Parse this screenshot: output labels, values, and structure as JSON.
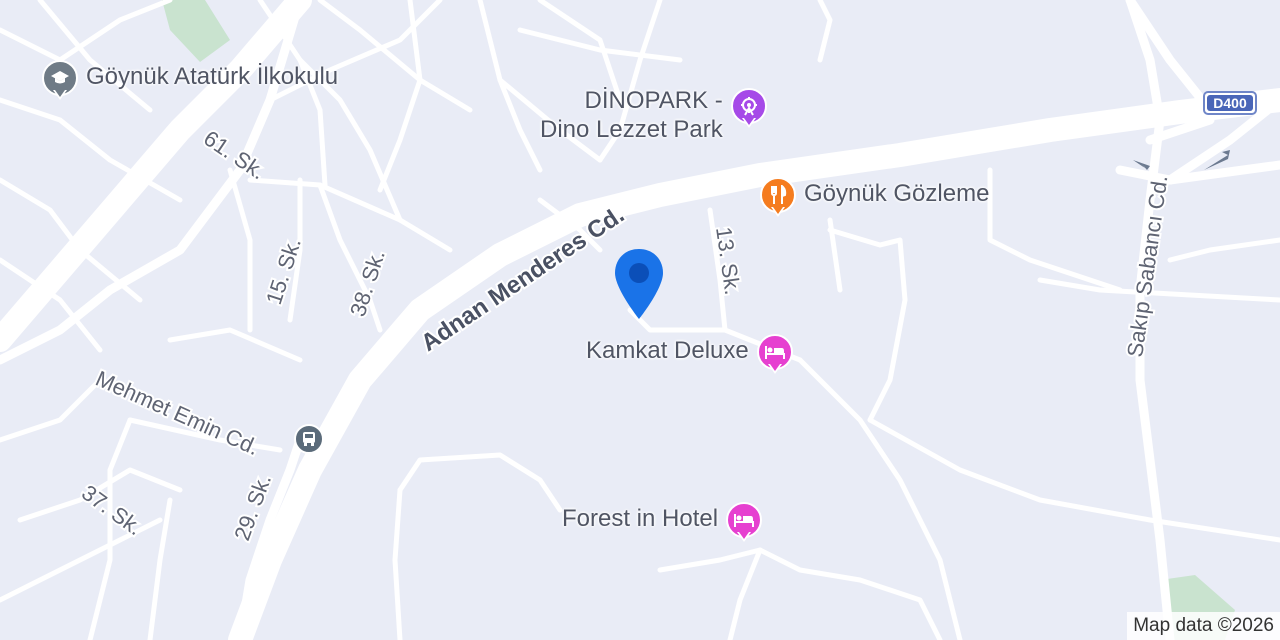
{
  "map": {
    "roads": [
      {
        "label": "Adnan Menderes Cd."
      },
      {
        "label": "61. Sk."
      },
      {
        "label": "15. Sk."
      },
      {
        "label": "38. Sk."
      },
      {
        "label": "13. Sk."
      },
      {
        "label": "Mehmet Emin Cd."
      },
      {
        "label": "37. Sk."
      },
      {
        "label": "29. Sk."
      },
      {
        "label": "Sakıp Sabancı Cd."
      }
    ],
    "highway_shield": "D400",
    "pois": {
      "school": {
        "line1": "Göynük Atatürk İlkokulu",
        "icon": "school-icon",
        "color": "#6f7b86"
      },
      "dinopark": {
        "line1": "DİNOPARK -",
        "line2": "Dino Lezzet Park",
        "icon": "amusement-park-icon",
        "color": "#a64ae8"
      },
      "gozleme": {
        "line1": "Göynük Gözleme",
        "icon": "restaurant-icon",
        "color": "#f57c1f"
      },
      "kamkat": {
        "line1": "Kamkat Deluxe",
        "icon": "hotel-bed-icon",
        "color": "#e640d0"
      },
      "forest": {
        "line1": "Forest in Hotel",
        "icon": "hotel-bed-icon",
        "color": "#e640d0"
      },
      "bus": {
        "icon": "bus-stop-icon",
        "color": "#5b6b7a"
      }
    },
    "location_pin_color": "#1a73e8",
    "copyright": "Map data ©2026"
  }
}
